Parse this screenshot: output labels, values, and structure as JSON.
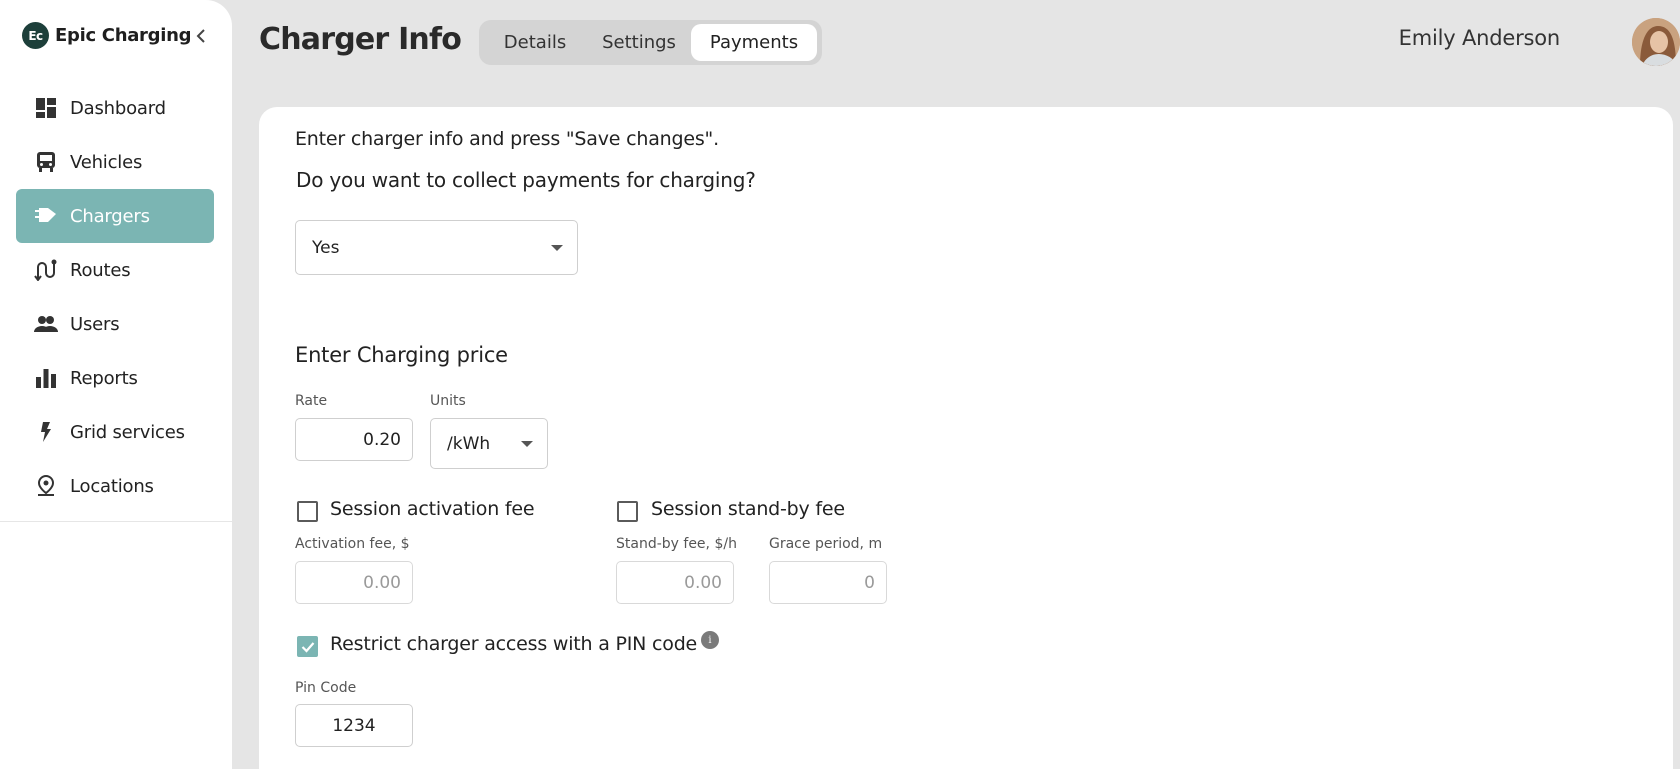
{
  "sidebar": {
    "brand": {
      "logo_text": "Ec",
      "name": "Epic Charging"
    },
    "items": [
      {
        "label": "Dashboard",
        "icon": "dashboard-icon",
        "active": false
      },
      {
        "label": "Vehicles",
        "icon": "bus-icon",
        "active": false
      },
      {
        "label": "Chargers",
        "icon": "charger-plug-icon",
        "active": true
      },
      {
        "label": "Routes",
        "icon": "route-icon",
        "active": false
      },
      {
        "label": "Users",
        "icon": "users-icon",
        "active": false
      },
      {
        "label": "Reports",
        "icon": "bar-chart-icon",
        "active": false
      },
      {
        "label": "Grid services",
        "icon": "lightning-icon",
        "active": false
      },
      {
        "label": "Locations",
        "icon": "location-pin-icon",
        "active": false
      }
    ]
  },
  "header": {
    "title": "Charger Info",
    "tabs": [
      {
        "label": "Details",
        "active": false
      },
      {
        "label": "Settings",
        "active": false
      },
      {
        "label": "Payments",
        "active": true
      }
    ],
    "user_name": "Emily Anderson"
  },
  "form": {
    "intro": "Enter charger info and press \"Save changes\".",
    "question": "Do you want to collect payments for charging?",
    "collect_payments": "Yes",
    "price_title": "Enter Charging price",
    "rate": {
      "label": "Rate",
      "value": "0.20"
    },
    "units": {
      "label": "Units",
      "value": "/kWh"
    },
    "activation_fee": {
      "label": "Session activation fee",
      "checked": false,
      "field_label": "Activation fee, $",
      "value": "0.00"
    },
    "standby_fee": {
      "label": "Session stand-by fee",
      "checked": false,
      "fee_label": "Stand-by fee, $/h",
      "fee_value": "0.00",
      "grace_label": "Grace period, m",
      "grace_value": "0"
    },
    "pin": {
      "label": "Restrict charger access with a PIN code",
      "checked": true,
      "info_icon_text": "i",
      "field_label": "Pin Code",
      "value": "1234"
    }
  },
  "colors": {
    "accent": "#7bb5b3",
    "brand_dark": "#1d3f3a",
    "background": "#e5e5e5"
  }
}
